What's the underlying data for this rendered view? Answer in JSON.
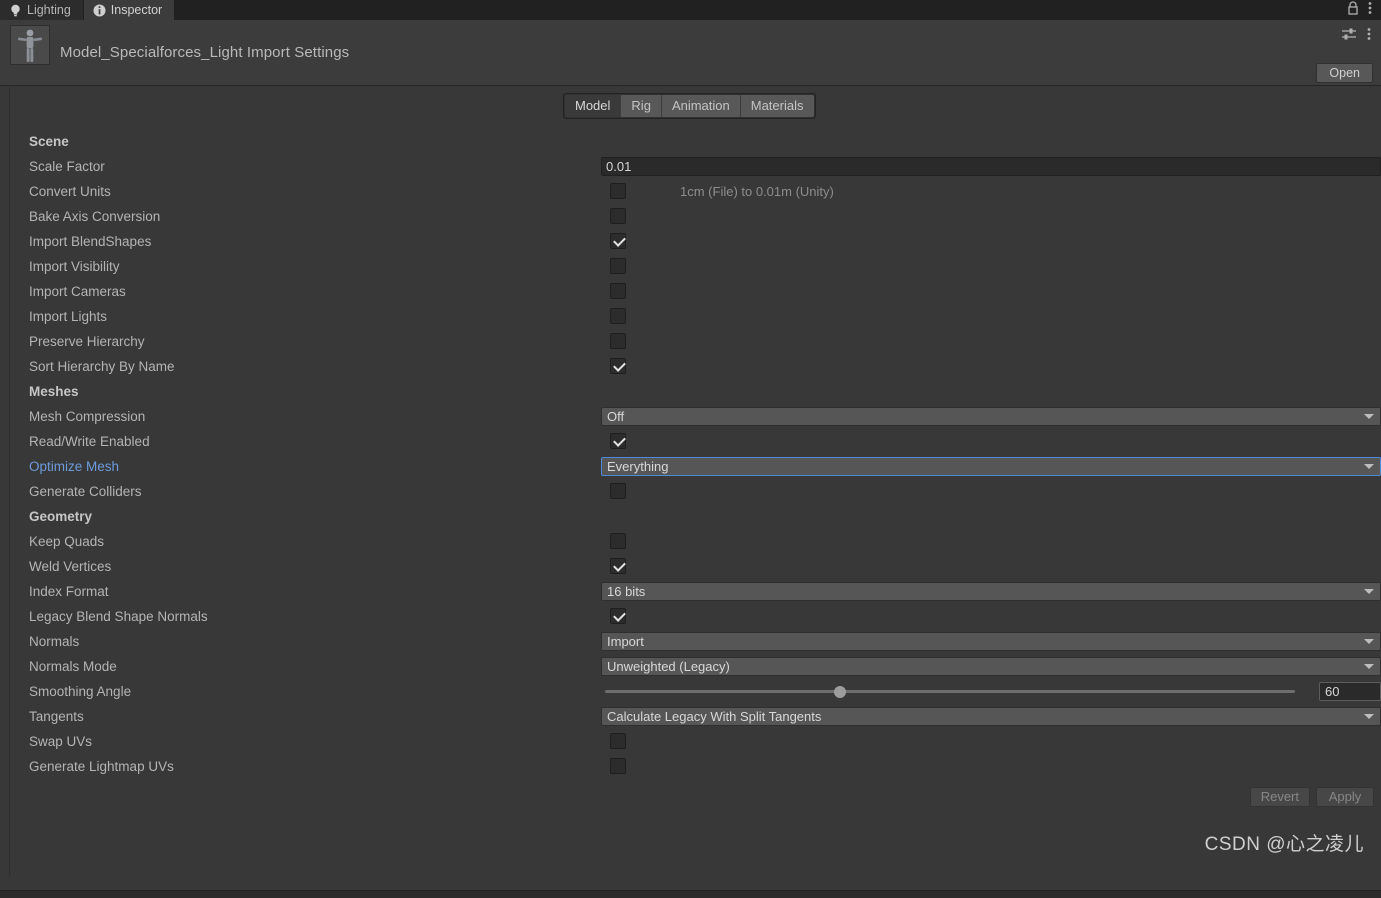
{
  "window_tabs": [
    {
      "label": "Lighting",
      "icon": "lightbulb-icon",
      "active": false
    },
    {
      "label": "Inspector",
      "icon": "info-circle-icon",
      "active": true
    }
  ],
  "titlebar_icons": {
    "lock": "lock-icon",
    "menu": "kebab-menu-icon"
  },
  "header": {
    "title": "Model_Specialforces_Light Import Settings",
    "thumbnail": "humanoid-model-thumbnail",
    "preset_icon": "preset-sliders-icon",
    "menu_icon": "kebab-menu-icon",
    "open_label": "Open"
  },
  "mode_tabs": [
    {
      "label": "Model",
      "active": true
    },
    {
      "label": "Rig",
      "active": false
    },
    {
      "label": "Animation",
      "active": false
    },
    {
      "label": "Materials",
      "active": false
    }
  ],
  "rows": [
    {
      "label": "Scene",
      "type": "section"
    },
    {
      "label": "Scale Factor",
      "type": "text",
      "value": "0.01"
    },
    {
      "label": "Convert Units",
      "type": "checkbox",
      "checked": false,
      "helper": "1cm (File) to 0.01m (Unity)"
    },
    {
      "label": "Bake Axis Conversion",
      "type": "checkbox",
      "checked": false
    },
    {
      "label": "Import BlendShapes",
      "type": "checkbox",
      "checked": true
    },
    {
      "label": "Import Visibility",
      "type": "checkbox",
      "checked": false
    },
    {
      "label": "Import Cameras",
      "type": "checkbox",
      "checked": false
    },
    {
      "label": "Import Lights",
      "type": "checkbox",
      "checked": false
    },
    {
      "label": "Preserve Hierarchy",
      "type": "checkbox",
      "checked": false
    },
    {
      "label": "Sort Hierarchy By Name",
      "type": "checkbox",
      "checked": true
    },
    {
      "label": "Meshes",
      "type": "section"
    },
    {
      "label": "Mesh Compression",
      "type": "dropdown",
      "value": "Off"
    },
    {
      "label": "Read/Write Enabled",
      "type": "checkbox",
      "checked": true
    },
    {
      "label": "Optimize Mesh",
      "type": "dropdown",
      "value": "Everything",
      "highlight": true,
      "focused": true
    },
    {
      "label": "Generate Colliders",
      "type": "checkbox",
      "checked": false
    },
    {
      "label": "Geometry",
      "type": "section"
    },
    {
      "label": "Keep Quads",
      "type": "checkbox",
      "checked": false
    },
    {
      "label": "Weld Vertices",
      "type": "checkbox",
      "checked": true
    },
    {
      "label": "Index Format",
      "type": "dropdown",
      "value": "16 bits"
    },
    {
      "label": "Legacy Blend Shape Normals",
      "type": "checkbox",
      "checked": true
    },
    {
      "label": "Normals",
      "type": "dropdown",
      "value": "Import"
    },
    {
      "label": "Normals Mode",
      "type": "dropdown",
      "value": "Unweighted (Legacy)"
    },
    {
      "label": "Smoothing Angle",
      "type": "slider",
      "value": "60",
      "percent": 34
    },
    {
      "label": "Tangents",
      "type": "dropdown",
      "value": "Calculate Legacy With Split Tangents"
    },
    {
      "label": "Swap UVs",
      "type": "checkbox",
      "checked": false
    },
    {
      "label": "Generate Lightmap UVs",
      "type": "checkbox",
      "checked": false
    }
  ],
  "footer": {
    "revert_label": "Revert",
    "apply_label": "Apply"
  },
  "watermark": "CSDN @心之凌儿",
  "colors": {
    "background": "#383838",
    "header": "#3c3c3c",
    "tabstrip": "#212121",
    "accent_blue": "#6c9bdc",
    "focus_border": "#4c8bd8",
    "dropdown": "#565656",
    "field": "#2a2a2a"
  }
}
